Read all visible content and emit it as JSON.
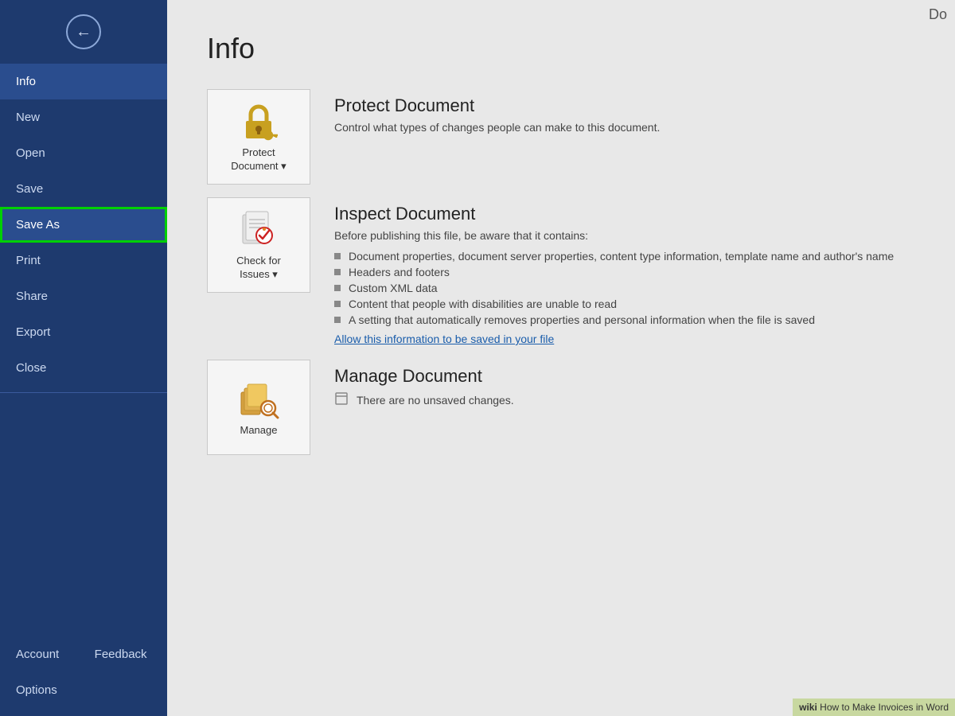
{
  "sidebar": {
    "back_button_label": "←",
    "items": [
      {
        "id": "info",
        "label": "Info",
        "active": true,
        "highlighted": false
      },
      {
        "id": "new",
        "label": "New",
        "active": false,
        "highlighted": false
      },
      {
        "id": "open",
        "label": "Open",
        "active": false,
        "highlighted": false
      },
      {
        "id": "save",
        "label": "Save",
        "active": false,
        "highlighted": false
      },
      {
        "id": "save-as",
        "label": "Save As",
        "active": false,
        "highlighted": true
      },
      {
        "id": "print",
        "label": "Print",
        "active": false,
        "highlighted": false
      },
      {
        "id": "share",
        "label": "Share",
        "active": false,
        "highlighted": false
      },
      {
        "id": "export",
        "label": "Export",
        "active": false,
        "highlighted": false
      },
      {
        "id": "close",
        "label": "Close",
        "active": false,
        "highlighted": false
      }
    ],
    "bottom_items": [
      {
        "id": "account",
        "label": "Account"
      },
      {
        "id": "feedback",
        "label": "Feedback"
      },
      {
        "id": "options",
        "label": "Options"
      }
    ]
  },
  "main": {
    "page_title": "Info",
    "top_right_partial": "Do",
    "sections": [
      {
        "id": "protect",
        "icon_label": "Protect\nDocument▾",
        "title": "Protect Document",
        "description": "Control what types of changes people can make to this document."
      },
      {
        "id": "inspect",
        "icon_label": "Check for\nIssues▾",
        "title": "Inspect Document",
        "description": "Before publishing this file, be aware that it contains:",
        "bullets": [
          "Document properties, document server properties, content type information, template name and author's name",
          "Headers and footers",
          "Custom XML data",
          "Content that people with disabilities are unable to read",
          "A setting that automatically removes properties and personal information when the file is saved"
        ],
        "link_text": "Allow this information to be saved in your file"
      },
      {
        "id": "manage",
        "icon_label": "Manage",
        "title": "Manage Document",
        "manage_row": "There are no unsaved changes."
      }
    ]
  },
  "watermark": {
    "wiki": "wiki",
    "text": "How to Make Invoices in Word"
  }
}
